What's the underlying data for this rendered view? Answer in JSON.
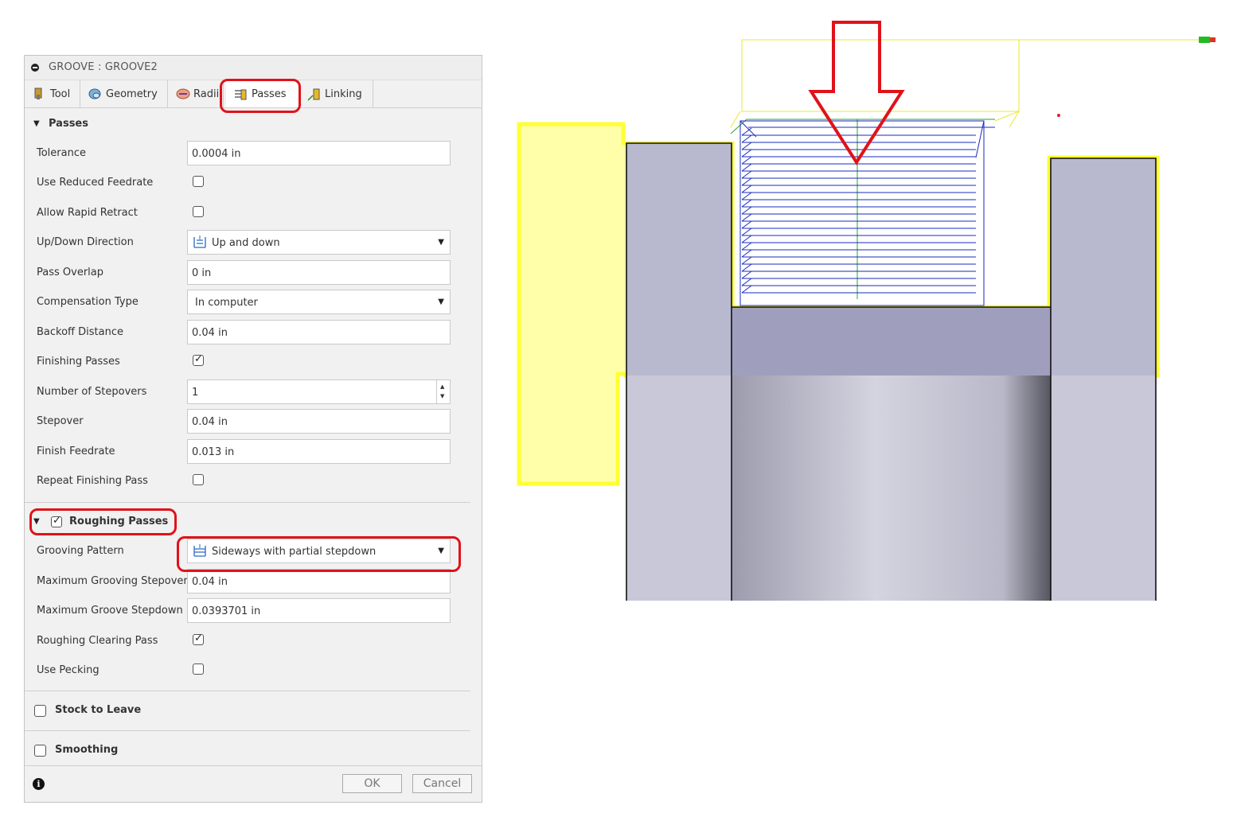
{
  "dialog": {
    "title": "GROOVE : GROOVE2",
    "tabs": [
      {
        "label": "Tool",
        "icon": "tool-icon"
      },
      {
        "label": "Geometry",
        "icon": "geometry-icon"
      },
      {
        "label": "Radii",
        "icon": "radii-icon"
      },
      {
        "label": "Passes",
        "icon": "passes-icon",
        "active": true
      },
      {
        "label": "Linking",
        "icon": "linking-icon"
      }
    ],
    "passes_section": {
      "label": "Passes",
      "tolerance": {
        "label": "Tolerance",
        "value": "0.0004 in"
      },
      "use_reduced_feedrate": {
        "label": "Use Reduced Feedrate",
        "checked": false
      },
      "allow_rapid_retract": {
        "label": "Allow Rapid Retract",
        "checked": false
      },
      "up_down_direction": {
        "label": "Up/Down Direction",
        "value": "Up and down"
      },
      "pass_overlap": {
        "label": "Pass Overlap",
        "value": "0 in"
      },
      "compensation_type": {
        "label": "Compensation Type",
        "value": "In computer"
      },
      "backoff_distance": {
        "label": "Backoff Distance",
        "value": "0.04 in"
      },
      "finishing_passes": {
        "label": "Finishing Passes",
        "checked": true
      },
      "number_of_stepovers": {
        "label": "Number of Stepovers",
        "value": "1"
      },
      "stepover": {
        "label": "Stepover",
        "value": "0.04 in"
      },
      "finish_feedrate": {
        "label": "Finish Feedrate",
        "value": "0.013 in"
      },
      "repeat_finishing_pass": {
        "label": "Repeat Finishing Pass",
        "checked": false
      }
    },
    "roughing_section": {
      "label": "Roughing Passes",
      "checked": true,
      "grooving_pattern": {
        "label": "Grooving Pattern",
        "value": "Sideways with partial stepdown"
      },
      "max_grooving_stepover": {
        "label": "Maximum Grooving Stepover",
        "value": "0.04 in"
      },
      "max_groove_stepdown": {
        "label": "Maximum Groove Stepdown",
        "value": "0.0393701 in"
      },
      "roughing_clearing_pass": {
        "label": "Roughing Clearing Pass",
        "checked": true
      },
      "use_pecking": {
        "label": "Use Pecking",
        "checked": false
      }
    },
    "stock_to_leave": {
      "label": "Stock to Leave",
      "checked": false
    },
    "smoothing": {
      "label": "Smoothing",
      "checked": false
    },
    "footer": {
      "ok_label": "OK",
      "cancel_label": "Cancel"
    }
  },
  "colors": {
    "highlight": "#e0121a",
    "toolpath": "#1a2bbf",
    "stock_outline": "#ffff33",
    "part_face": "#b8b8d0"
  }
}
